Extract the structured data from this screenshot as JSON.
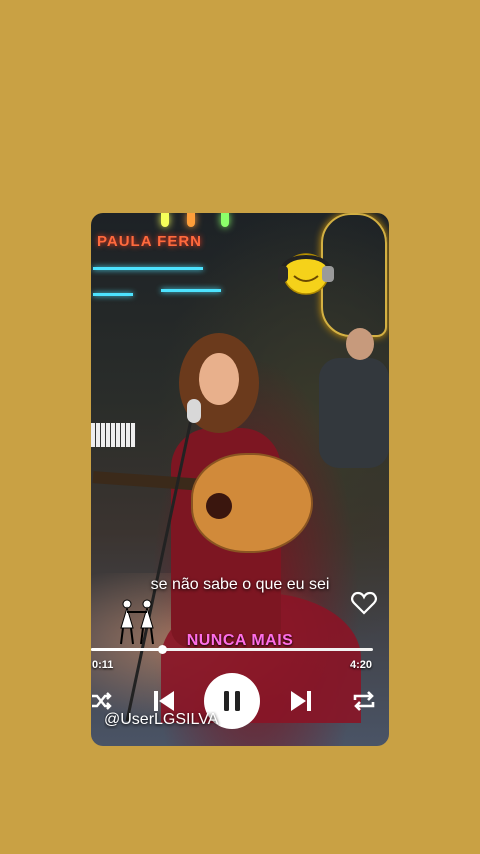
{
  "background_color": "#c9a144",
  "scene": {
    "neon_sign_text": "PAULA FERN",
    "bulb_colors": [
      "#f6ff5a",
      "#ff9f3a",
      "#8cff6a"
    ]
  },
  "lyrics_line": "se não sabe o que eu sei",
  "song_title": "NUNCA MAIS",
  "song_title_color": "#ff6ee8",
  "playback": {
    "elapsed": "0:11",
    "total": "4:20",
    "progress": 0.25
  },
  "controls": {
    "shuffle_icon": "shuffle-icon",
    "previous_icon": "skip-previous-icon",
    "pause_icon": "pause-icon",
    "next_icon": "skip-next-icon",
    "repeat_icon": "repeat-icon"
  },
  "favorite_icon": "heart-outline-icon",
  "watermark": "@UserLGSILVA"
}
